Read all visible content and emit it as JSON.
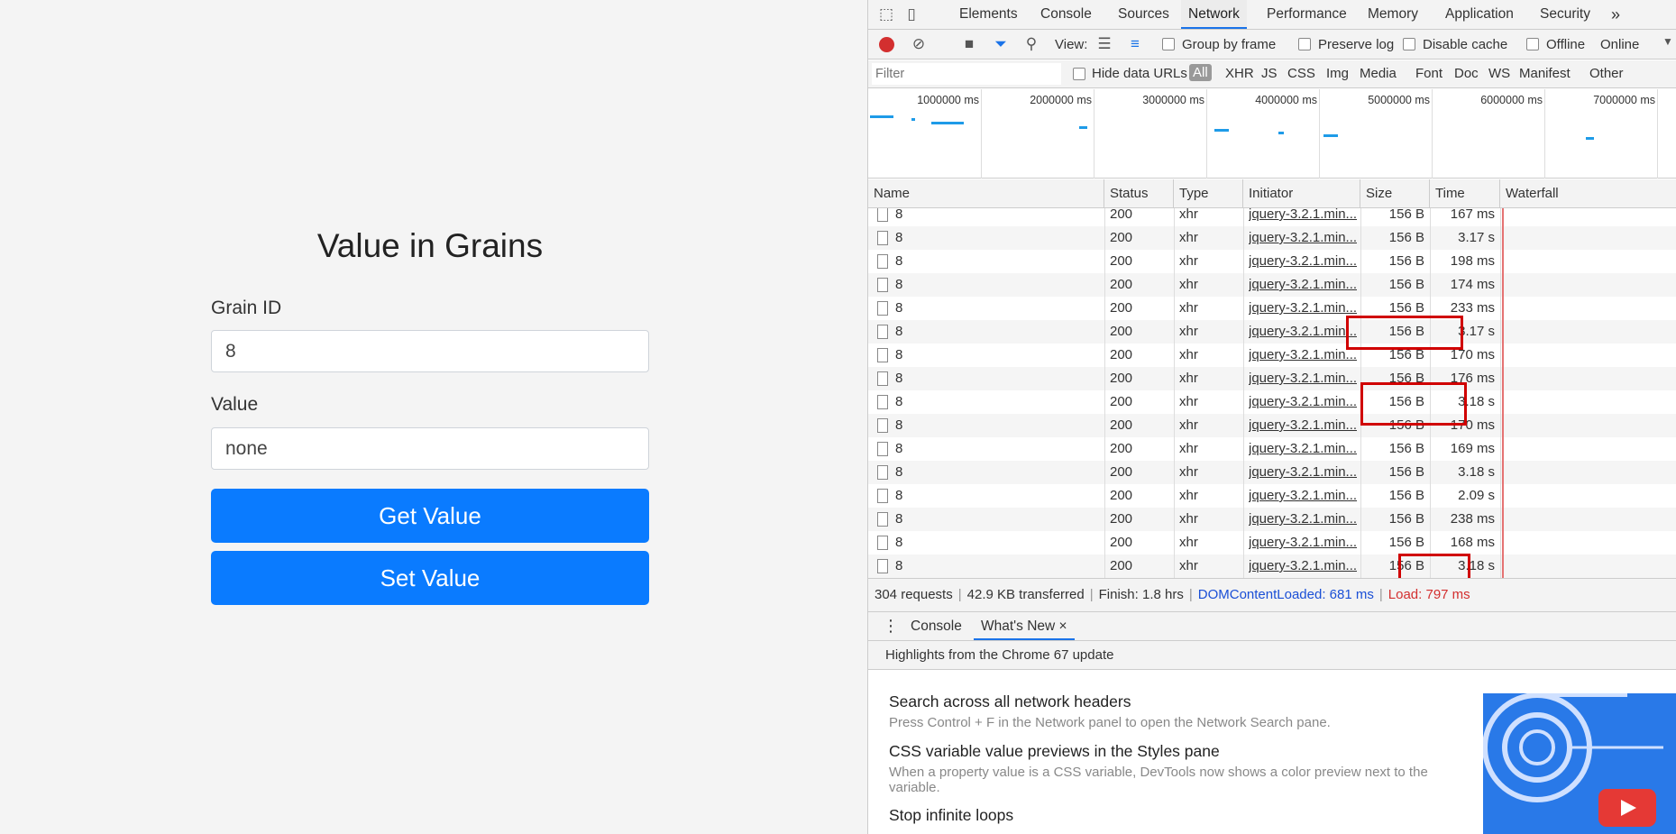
{
  "app": {
    "title": "Value in Grains",
    "grain_label": "Grain ID",
    "grain_value": "8",
    "value_label": "Value",
    "value_value": "none",
    "get_button": "Get Value",
    "set_button": "Set Value"
  },
  "devtools": {
    "tabs": [
      "Elements",
      "Console",
      "Sources",
      "Network",
      "Performance",
      "Memory",
      "Application",
      "Security"
    ],
    "more_tabs": "»",
    "toolbar": {
      "view_label": "View:",
      "group_by_frame": "Group by frame",
      "preserve_log": "Preserve log",
      "disable_cache": "Disable cache",
      "offline": "Offline",
      "throttle": "Online"
    },
    "filter": {
      "placeholder": "Filter",
      "hide_data_urls": "Hide data URLs",
      "types": [
        "All",
        "XHR",
        "JS",
        "CSS",
        "Img",
        "Media",
        "Font",
        "Doc",
        "WS",
        "Manifest",
        "Other"
      ]
    },
    "overview_ticks": [
      "1000000 ms",
      "2000000 ms",
      "3000000 ms",
      "4000000 ms",
      "5000000 ms",
      "6000000 ms",
      "7000000 ms"
    ],
    "columns": [
      "Name",
      "Status",
      "Type",
      "Initiator",
      "Size",
      "Time",
      "Waterfall"
    ],
    "rows": [
      {
        "name": "8",
        "status": "200",
        "type": "xhr",
        "initiator": "jquery-3.2.1.min...",
        "size": "156 B",
        "time": "167 ms"
      },
      {
        "name": "8",
        "status": "200",
        "type": "xhr",
        "initiator": "jquery-3.2.1.min...",
        "size": "156 B",
        "time": "3.17 s"
      },
      {
        "name": "8",
        "status": "200",
        "type": "xhr",
        "initiator": "jquery-3.2.1.min...",
        "size": "156 B",
        "time": "198 ms"
      },
      {
        "name": "8",
        "status": "200",
        "type": "xhr",
        "initiator": "jquery-3.2.1.min...",
        "size": "156 B",
        "time": "174 ms"
      },
      {
        "name": "8",
        "status": "200",
        "type": "xhr",
        "initiator": "jquery-3.2.1.min...",
        "size": "156 B",
        "time": "233 ms"
      },
      {
        "name": "8",
        "status": "200",
        "type": "xhr",
        "initiator": "jquery-3.2.1.min...",
        "size": "156 B",
        "time": "3.17 s"
      },
      {
        "name": "8",
        "status": "200",
        "type": "xhr",
        "initiator": "jquery-3.2.1.min...",
        "size": "156 B",
        "time": "170 ms"
      },
      {
        "name": "8",
        "status": "200",
        "type": "xhr",
        "initiator": "jquery-3.2.1.min...",
        "size": "156 B",
        "time": "176 ms"
      },
      {
        "name": "8",
        "status": "200",
        "type": "xhr",
        "initiator": "jquery-3.2.1.min...",
        "size": "156 B",
        "time": "3.18 s"
      },
      {
        "name": "8",
        "status": "200",
        "type": "xhr",
        "initiator": "jquery-3.2.1.min...",
        "size": "156 B",
        "time": "170 ms"
      },
      {
        "name": "8",
        "status": "200",
        "type": "xhr",
        "initiator": "jquery-3.2.1.min...",
        "size": "156 B",
        "time": "169 ms"
      },
      {
        "name": "8",
        "status": "200",
        "type": "xhr",
        "initiator": "jquery-3.2.1.min...",
        "size": "156 B",
        "time": "3.18 s"
      },
      {
        "name": "8",
        "status": "200",
        "type": "xhr",
        "initiator": "jquery-3.2.1.min...",
        "size": "156 B",
        "time": "2.09 s"
      },
      {
        "name": "8",
        "status": "200",
        "type": "xhr",
        "initiator": "jquery-3.2.1.min...",
        "size": "156 B",
        "time": "238 ms"
      },
      {
        "name": "8",
        "status": "200",
        "type": "xhr",
        "initiator": "jquery-3.2.1.min...",
        "size": "156 B",
        "time": "168 ms"
      },
      {
        "name": "8",
        "status": "200",
        "type": "xhr",
        "initiator": "jquery-3.2.1.min...",
        "size": "156 B",
        "time": "3.18 s"
      }
    ],
    "summary": {
      "requests": "304 requests",
      "transferred": "42.9 KB transferred",
      "finish": "Finish: 1.8 hrs",
      "dom_content_loaded": "DOMContentLoaded: 681 ms",
      "load": "Load: 797 ms"
    },
    "drawer": {
      "tabs": [
        "Console",
        "What's New"
      ],
      "close": "×",
      "highlights": "Highlights from the Chrome 67 update",
      "items": [
        {
          "title": "Search across all network headers",
          "text": "Press Control + F in the Network panel to open the Network Search pane."
        },
        {
          "title": "CSS variable value previews in the Styles pane",
          "text": "When a property value is a CSS variable, DevTools now shows a color preview next to the variable."
        },
        {
          "title": "Stop infinite loops",
          "text": ""
        }
      ]
    },
    "colors": {
      "accent": "#1a73e8",
      "record": "#d32f2f",
      "highlight_box": "#d00000",
      "app_button": "#0a7bff"
    }
  }
}
